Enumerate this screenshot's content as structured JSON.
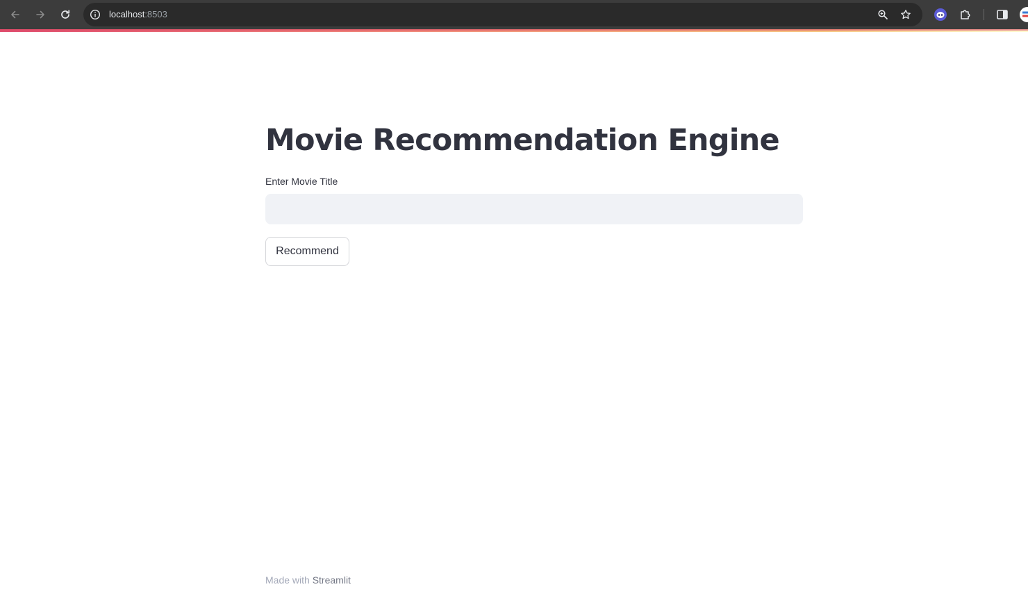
{
  "browser": {
    "url_host": "localhost",
    "url_port": ":8503"
  },
  "app": {
    "title": "Movie Recommendation Engine",
    "input": {
      "label": "Enter Movie Title",
      "value": "",
      "placeholder": ""
    },
    "recommend_button": "Recommend"
  },
  "footer": {
    "prefix": "Made with",
    "brand": "Streamlit"
  },
  "colors": {
    "chrome_bg": "#3c3c3c",
    "omnibox_bg": "#2a2a2a",
    "text_primary": "#31333f",
    "input_bg": "#f0f2f6",
    "decoration_gradient_start": "#e04d6f",
    "decoration_gradient_end": "#fffbd0"
  },
  "icons": [
    "back-arrow-icon",
    "forward-arrow-icon",
    "reload-icon",
    "site-info-icon",
    "zoom-icon",
    "bookmark-star-icon",
    "extension-ghost-icon",
    "extensions-puzzle-icon",
    "side-panel-icon",
    "profile-avatar-icon"
  ]
}
